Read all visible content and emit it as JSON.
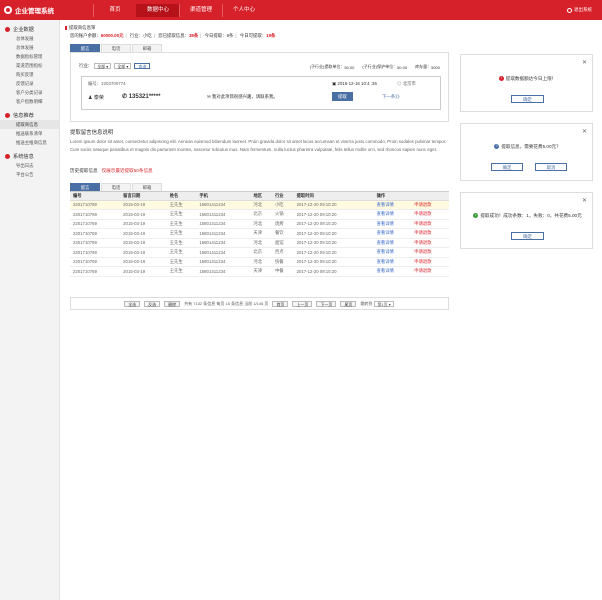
{
  "header": {
    "title": "企业管理系统",
    "nav": [
      "首页",
      "数据中心",
      "渠道管理",
      "个人中心"
    ],
    "active_nav": 1,
    "logout": "退出系统"
  },
  "sidebar": {
    "groups": [
      {
        "title": "企业数据",
        "items": [
          "总体发展",
          "总体发展",
          "数据指标管理",
          "渠道范围指标",
          "购买反馈",
          "反馈记录",
          "客户分类记录",
          "客户指数明细"
        ]
      },
      {
        "title": "信息推荐",
        "items": [
          "提取商信息",
          "推送联系清单",
          "推送主推商信息"
        ]
      },
      {
        "title": "系统信息",
        "items": [
          "导出日志",
          "平台公告"
        ]
      }
    ],
    "active": "提取商信息"
  },
  "breadcrumb": "提取商信息筛",
  "stats": {
    "balance_label": "您的账户余额：",
    "balance": "60000.00元",
    "industry_label": "行业：",
    "industry": "小吃",
    "extracted_label": "您已提取信息：",
    "extracted": "38条",
    "today_label": "今日提取：",
    "today": "9条",
    "remaining_label": "今日可提取：",
    "remaining": "19条"
  },
  "tabs": [
    "留言",
    "电话",
    "邮箱"
  ],
  "filter": {
    "industry_label": "行业：",
    "select1": "全部",
    "select2": "全部",
    "query": "查询",
    "u1": "(子行业)提取单位：",
    "v1": "50.00",
    "u2": "(子行业)保护单位：",
    "v2": "50.00",
    "u3": "库存量：",
    "v3": "5000"
  },
  "card": {
    "id": "编号：2203700774",
    "date": "2016-12-16  10:4 :36",
    "location": "北京市",
    "name": "泰荣",
    "phone": "135321*****",
    "message": "我对此项目很感兴趣，请联系我。",
    "btn": "提取",
    "next": "下一条》》"
  },
  "info": {
    "title": "提取留言信息说明",
    "text": "Lorem ipsum dolor sit amet, consectetur adipiscing elit. Aenean euismod bibendum laoreet. Proin gravida dolor sit amet lacus accumsan et viverra justo commodo. Proin sodales pulvinar tempor. Cum sociis natoque penatibus et magnis dis parturient montes, nascetur ridiculus mus. Nam fermentum, nulla luctus pharetra vulputate, felis tellus mollis orci, sed rhoncus sapien nunc eget."
  },
  "history": {
    "label": "历史提取信息",
    "note": "仅展示最近提取50条信息"
  },
  "table": {
    "headers": [
      "编号",
      "留言日期",
      "姓名",
      "手机",
      "地区",
      "行业",
      "提取时间",
      "操作",
      ""
    ],
    "rows": [
      [
        "2201710769",
        "2015-03-19",
        "王先生",
        "15801411234",
        "河北",
        "小吃",
        "2017-12-20 09:10:20",
        "查看详情",
        "申请退款"
      ],
      [
        "2201710769",
        "2015-03-19",
        "王先生",
        "15801411234",
        "北京",
        "火锅",
        "2017-12-20 09:10:20",
        "查看详情",
        "申请退款"
      ],
      [
        "2201710769",
        "2015-03-19",
        "王先生",
        "15801411234",
        "河北",
        "烧烤",
        "2017-12-20 09:10:20",
        "查看详情",
        "申请退款"
      ],
      [
        "2201710769",
        "2015-03-19",
        "王先生",
        "15801411234",
        "天津",
        "餐饮",
        "2017-12-20 09:10:20",
        "查看详情",
        "申请退款"
      ],
      [
        "2201710769",
        "2015-03-19",
        "王先生",
        "15801411234",
        "河北",
        "面馆",
        "2017-12-20 09:10:20",
        "查看详情",
        "申请退款"
      ],
      [
        "2201710769",
        "2015-03-19",
        "王先生",
        "15801411234",
        "北京",
        "西点",
        "2017-12-20 09:10:20",
        "查看详情",
        "申请退款"
      ],
      [
        "2201710769",
        "2015-03-19",
        "王先生",
        "15801411234",
        "河北",
        "快餐",
        "2017-12-20 09:10:20",
        "查看详情",
        "申请退款"
      ],
      [
        "2201710769",
        "2015-03-19",
        "王先生",
        "15801411234",
        "天津",
        "中餐",
        "2017-12-20 09:10:20",
        "查看详情",
        "申请退款"
      ]
    ]
  },
  "pager": {
    "b1": "全选",
    "b2": "反选",
    "b3": "删除",
    "info": "共有 7132 条信息 每页 15 条信息 当前 1/146 页",
    "first": "首页",
    "prev": "上一页",
    "next": "下一页",
    "last": "尾页",
    "jump": "跳转到",
    "page": "第1页"
  },
  "dialogs": [
    {
      "msg": "提取数据额达今日上限！",
      "btn": "确定"
    },
    {
      "msg": "提取信息，需要花费5.00元？",
      "btn1": "确定",
      "btn2": "取消"
    },
    {
      "msg": "提取成功！成功条数：1，失败：0，共花费5.00元",
      "btn": "确定"
    }
  ],
  "colors": {
    "brand": "#d7212a",
    "blue": "#4a6fa5"
  }
}
